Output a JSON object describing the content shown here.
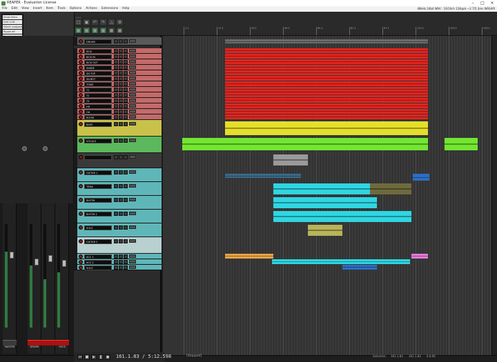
{
  "app": {
    "title": "REAPER - Evaluation License",
    "status_right": "48kHz 24bit WAV : 16/16ch 128spls ~2.7/5.3ms WASAPI"
  },
  "menu": [
    "File",
    "Edit",
    "View",
    "Insert",
    "Item",
    "Track",
    "Options",
    "Actions",
    "Extensions",
    "Help"
  ],
  "tracks": [
    {
      "name": "DRUMS",
      "color": "#5a5a5a"
    },
    {
      "name": "KICK",
      "color": "#c46a6a"
    },
    {
      "name": "KICK IN",
      "color": "#c46a6a"
    },
    {
      "name": "KICK OUT",
      "color": "#c46a6a"
    },
    {
      "name": "SNARE",
      "color": "#c46a6a"
    },
    {
      "name": "SN TOP",
      "color": "#c46a6a"
    },
    {
      "name": "SN BOT",
      "color": "#c46a6a"
    },
    {
      "name": "TOMS",
      "color": "#c46a6a"
    },
    {
      "name": "T1",
      "color": "#c46a6a"
    },
    {
      "name": "T2",
      "color": "#c46a6a"
    },
    {
      "name": "T3",
      "color": "#c46a6a"
    },
    {
      "name": "HH",
      "color": "#c46a6a"
    },
    {
      "name": "OH",
      "color": "#c46a6a"
    },
    {
      "name": "ROOM",
      "color": "#c46a6a"
    },
    {
      "name": "BASS",
      "color": "#c8c24a"
    },
    {
      "name": "VOCALS",
      "color": "#5cb85c"
    },
    {
      "name": "",
      "color": "#3a3a3a"
    },
    {
      "name": "GUITAR 1",
      "color": "#5fb6b8"
    },
    {
      "name": "TEMA",
      "color": "#5fb6b8"
    },
    {
      "name": "RHYTM",
      "color": "#5fb6b8"
    },
    {
      "name": "RHYTM 2",
      "color": "#5fb6b8"
    },
    {
      "name": "SOLO",
      "color": "#5fb6b8"
    },
    {
      "name": "GUITAR 2",
      "color": "#b8d0d0"
    },
    {
      "name": "ACC 1",
      "color": "#5fb6b8"
    },
    {
      "name": "ACC 2",
      "color": "#5fb6b8"
    },
    {
      "name": "SOLO",
      "color": "#5fb6b8"
    }
  ],
  "mixer": {
    "strips": [
      "DRUMS",
      "",
      "VOCS",
      "",
      ""
    ],
    "master_label": "MASTER"
  },
  "transport": {
    "position": "161.1.83 / 5:12.598",
    "state": "[Stopped]",
    "fields": [
      "Selection:",
      "161.1.83",
      "161.1.83",
      "0.0.00"
    ]
  },
  "colors": {
    "drums_item": "#e0251f",
    "bass_item": "#e5df2a",
    "vocal_item": "#72e631",
    "guitar_item": "#2fd6e2",
    "orange_item": "#e7a445",
    "pink_item": "#e27ad9",
    "blue_item": "#2c6ec2"
  },
  "ruler_labels": [
    "1.1",
    "17.1",
    "33.1",
    "49.1",
    "65.1",
    "81.1",
    "97.1",
    "113.1",
    "129.1",
    "145.1",
    "161.1",
    "177.1",
    "193.1"
  ],
  "snap": [
    "Show items",
    "Grid 1/16",
    "Select snapped",
    "Ripple off",
    "Envelope lock",
    "Item lock",
    "Auto crossfade"
  ]
}
